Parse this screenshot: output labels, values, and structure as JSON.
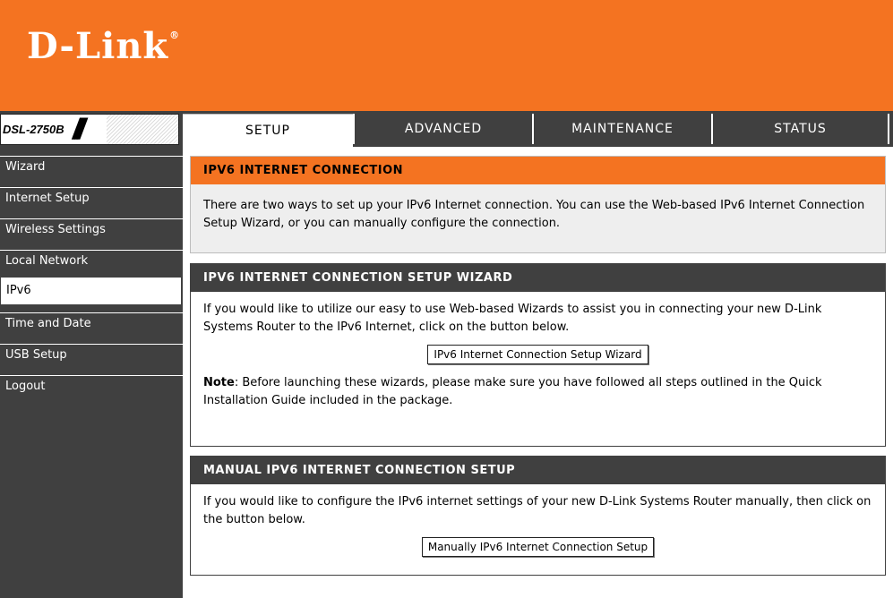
{
  "brand": {
    "logo_text": "D-Link",
    "registered_mark": "®",
    "model": "DSL-2750B"
  },
  "colors": {
    "orange": "#f47321",
    "dark": "#404040",
    "white": "#ffffff"
  },
  "tabs": [
    {
      "label": "SETUP",
      "active": true
    },
    {
      "label": "ADVANCED",
      "active": false
    },
    {
      "label": "MAINTENANCE",
      "active": false
    },
    {
      "label": "STATUS",
      "active": false
    }
  ],
  "sidebar": {
    "items": [
      {
        "label": "Wizard"
      },
      {
        "label": "Internet Setup"
      },
      {
        "label": "Wireless Settings"
      },
      {
        "label": "Local Network"
      },
      {
        "label": "IPv6",
        "active": true
      },
      {
        "label": "Time and Date"
      },
      {
        "label": "USB Setup"
      },
      {
        "label": "Logout"
      }
    ]
  },
  "intro": {
    "title": "IPV6 INTERNET CONNECTION",
    "text": "There are two ways to set up your IPv6 Internet connection. You can use the Web-based IPv6 Internet Connection Setup Wizard, or you can manually configure the connection."
  },
  "wizard": {
    "title": "IPV6 INTERNET CONNECTION SETUP WIZARD",
    "text": "If you would like to utilize our easy to use Web-based Wizards to assist you in connecting your new D-Link Systems Router to the IPv6 Internet, click on the button below.",
    "button": "IPv6 Internet Connection Setup Wizard",
    "note_label": "Note",
    "note_text": ": Before launching these wizards, please make sure you have followed all steps outlined in the Quick Installation Guide included in the package."
  },
  "manual": {
    "title": "MANUAL IPV6 INTERNET CONNECTION SETUP",
    "text": "If you would like to configure the IPv6 internet settings of your new D-Link Systems Router manually, then click on the button below.",
    "button": "Manually IPv6 Internet Connection Setup"
  }
}
